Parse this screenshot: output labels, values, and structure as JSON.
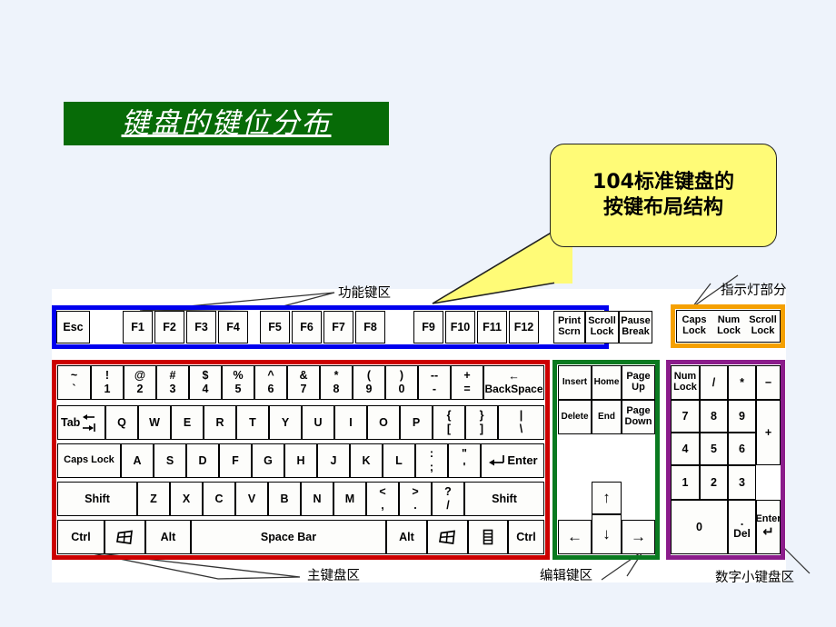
{
  "slide": {
    "title": "键盘的键位分布",
    "callout": {
      "line1": "104标准键盘的",
      "line2": "按键布局结构"
    },
    "colors": {
      "background": "#eef3fb",
      "title_bg": "#076B07",
      "title_text": "#ffffff",
      "callout_bg": "#FFFB77",
      "function_row_border": "#0000EE",
      "indicator_border": "#F5A000",
      "main_border": "#CC0000",
      "edit_border": "#0A7A20",
      "numpad_border": "#8B1C8B",
      "board_bg": "#ffffff"
    }
  },
  "annotations": {
    "function_area": "功能键区",
    "indicator_area": "指示灯部分",
    "main_area": "主键盘区",
    "edit_area": "编辑键区",
    "numpad_area": "数字小键盘区"
  },
  "function_row": {
    "keys": [
      {
        "label": "Esc"
      },
      {
        "label": "F1"
      },
      {
        "label": "F2"
      },
      {
        "label": "F3"
      },
      {
        "label": "F4"
      },
      {
        "label": "F5"
      },
      {
        "label": "F6"
      },
      {
        "label": "F7"
      },
      {
        "label": "F8"
      },
      {
        "label": "F9"
      },
      {
        "label": "F10"
      },
      {
        "label": "F11"
      },
      {
        "label": "F12"
      },
      {
        "top": "Print",
        "bottom": "Scrn"
      },
      {
        "top": "Scroll",
        "bottom": "Lock"
      },
      {
        "top": "Pause",
        "bottom": "Break"
      }
    ]
  },
  "indicators": {
    "items": [
      {
        "top": "Caps",
        "bottom": "Lock"
      },
      {
        "top": "Num",
        "bottom": "Lock"
      },
      {
        "top": "Scroll",
        "bottom": "Lock"
      }
    ]
  },
  "main_keyboard": {
    "row1": [
      {
        "upper": "~",
        "lower": "`"
      },
      {
        "upper": "!",
        "lower": "1"
      },
      {
        "upper": "@",
        "lower": "2"
      },
      {
        "upper": "#",
        "lower": "3"
      },
      {
        "upper": "$",
        "lower": "4"
      },
      {
        "upper": "%",
        "lower": "5"
      },
      {
        "upper": "^",
        "lower": "6"
      },
      {
        "upper": "&",
        "lower": "7"
      },
      {
        "upper": "*",
        "lower": "8"
      },
      {
        "upper": "(",
        "lower": "9"
      },
      {
        "upper": ")",
        "lower": "0"
      },
      {
        "upper": "--",
        "lower": "-"
      },
      {
        "upper": "+",
        "lower": "="
      },
      {
        "upper": "←",
        "lower": "BackSpace"
      }
    ],
    "row2": [
      {
        "label": "Tab"
      },
      {
        "label": "Q"
      },
      {
        "label": "W"
      },
      {
        "label": "E"
      },
      {
        "label": "R"
      },
      {
        "label": "T"
      },
      {
        "label": "Y"
      },
      {
        "label": "U"
      },
      {
        "label": "I"
      },
      {
        "label": "O"
      },
      {
        "label": "P"
      },
      {
        "upper": "{",
        "lower": "["
      },
      {
        "upper": "}",
        "lower": "]"
      },
      {
        "upper": "|",
        "lower": "\\"
      }
    ],
    "row3": [
      {
        "label": "Caps Lock"
      },
      {
        "label": "A"
      },
      {
        "label": "S"
      },
      {
        "label": "D"
      },
      {
        "label": "F"
      },
      {
        "label": "G"
      },
      {
        "label": "H"
      },
      {
        "label": "J"
      },
      {
        "label": "K"
      },
      {
        "label": "L"
      },
      {
        "upper": ":",
        "lower": ";"
      },
      {
        "upper": "\"",
        "lower": "'"
      },
      {
        "label": "Enter"
      }
    ],
    "row4": [
      {
        "label": "Shift"
      },
      {
        "label": "Z"
      },
      {
        "label": "X"
      },
      {
        "label": "C"
      },
      {
        "label": "V"
      },
      {
        "label": "B"
      },
      {
        "label": "N"
      },
      {
        "label": "M"
      },
      {
        "upper": "<",
        "lower": ","
      },
      {
        "upper": ">",
        "lower": "."
      },
      {
        "upper": "?",
        "lower": "/"
      },
      {
        "label": "Shift"
      }
    ],
    "row5": [
      {
        "label": "Ctrl"
      },
      {
        "label": "win-key"
      },
      {
        "label": "Alt"
      },
      {
        "label": "Space Bar"
      },
      {
        "label": "Alt"
      },
      {
        "label": "win-key"
      },
      {
        "label": "menu-key"
      },
      {
        "label": "Ctrl"
      }
    ]
  },
  "edit_block": {
    "row1": [
      {
        "label": "Insert"
      },
      {
        "label": "Home"
      },
      {
        "top": "Page",
        "bottom": "Up"
      }
    ],
    "row2": [
      {
        "label": "Delete"
      },
      {
        "label": "End"
      },
      {
        "top": "Page",
        "bottom": "Down"
      }
    ],
    "arrows": {
      "up": "↑",
      "left": "←",
      "down": "↓",
      "right": "→"
    }
  },
  "numpad": {
    "row1": [
      {
        "top": "Num",
        "bottom": "Lock"
      },
      {
        "label": "/"
      },
      {
        "label": "*"
      },
      {
        "label": "−"
      }
    ],
    "row2": [
      {
        "label": "7"
      },
      {
        "label": "8"
      },
      {
        "label": "9"
      }
    ],
    "plus": "+",
    "row3": [
      {
        "label": "4"
      },
      {
        "label": "5"
      },
      {
        "label": "6"
      }
    ],
    "row4": [
      {
        "label": "1"
      },
      {
        "label": "2"
      },
      {
        "label": "3"
      }
    ],
    "row5_zero": "0",
    "row5_del": {
      "top": ".",
      "bottom": "Del"
    },
    "enter": "Enter",
    "enter_arrow": "↵"
  },
  "icons": {
    "windows_key": "win-key-icon",
    "menu_key": "menu-key-icon",
    "backspace_arrow": "←",
    "enter_arrow": "↵",
    "tab_arrows": "tab-arrows-icon"
  }
}
